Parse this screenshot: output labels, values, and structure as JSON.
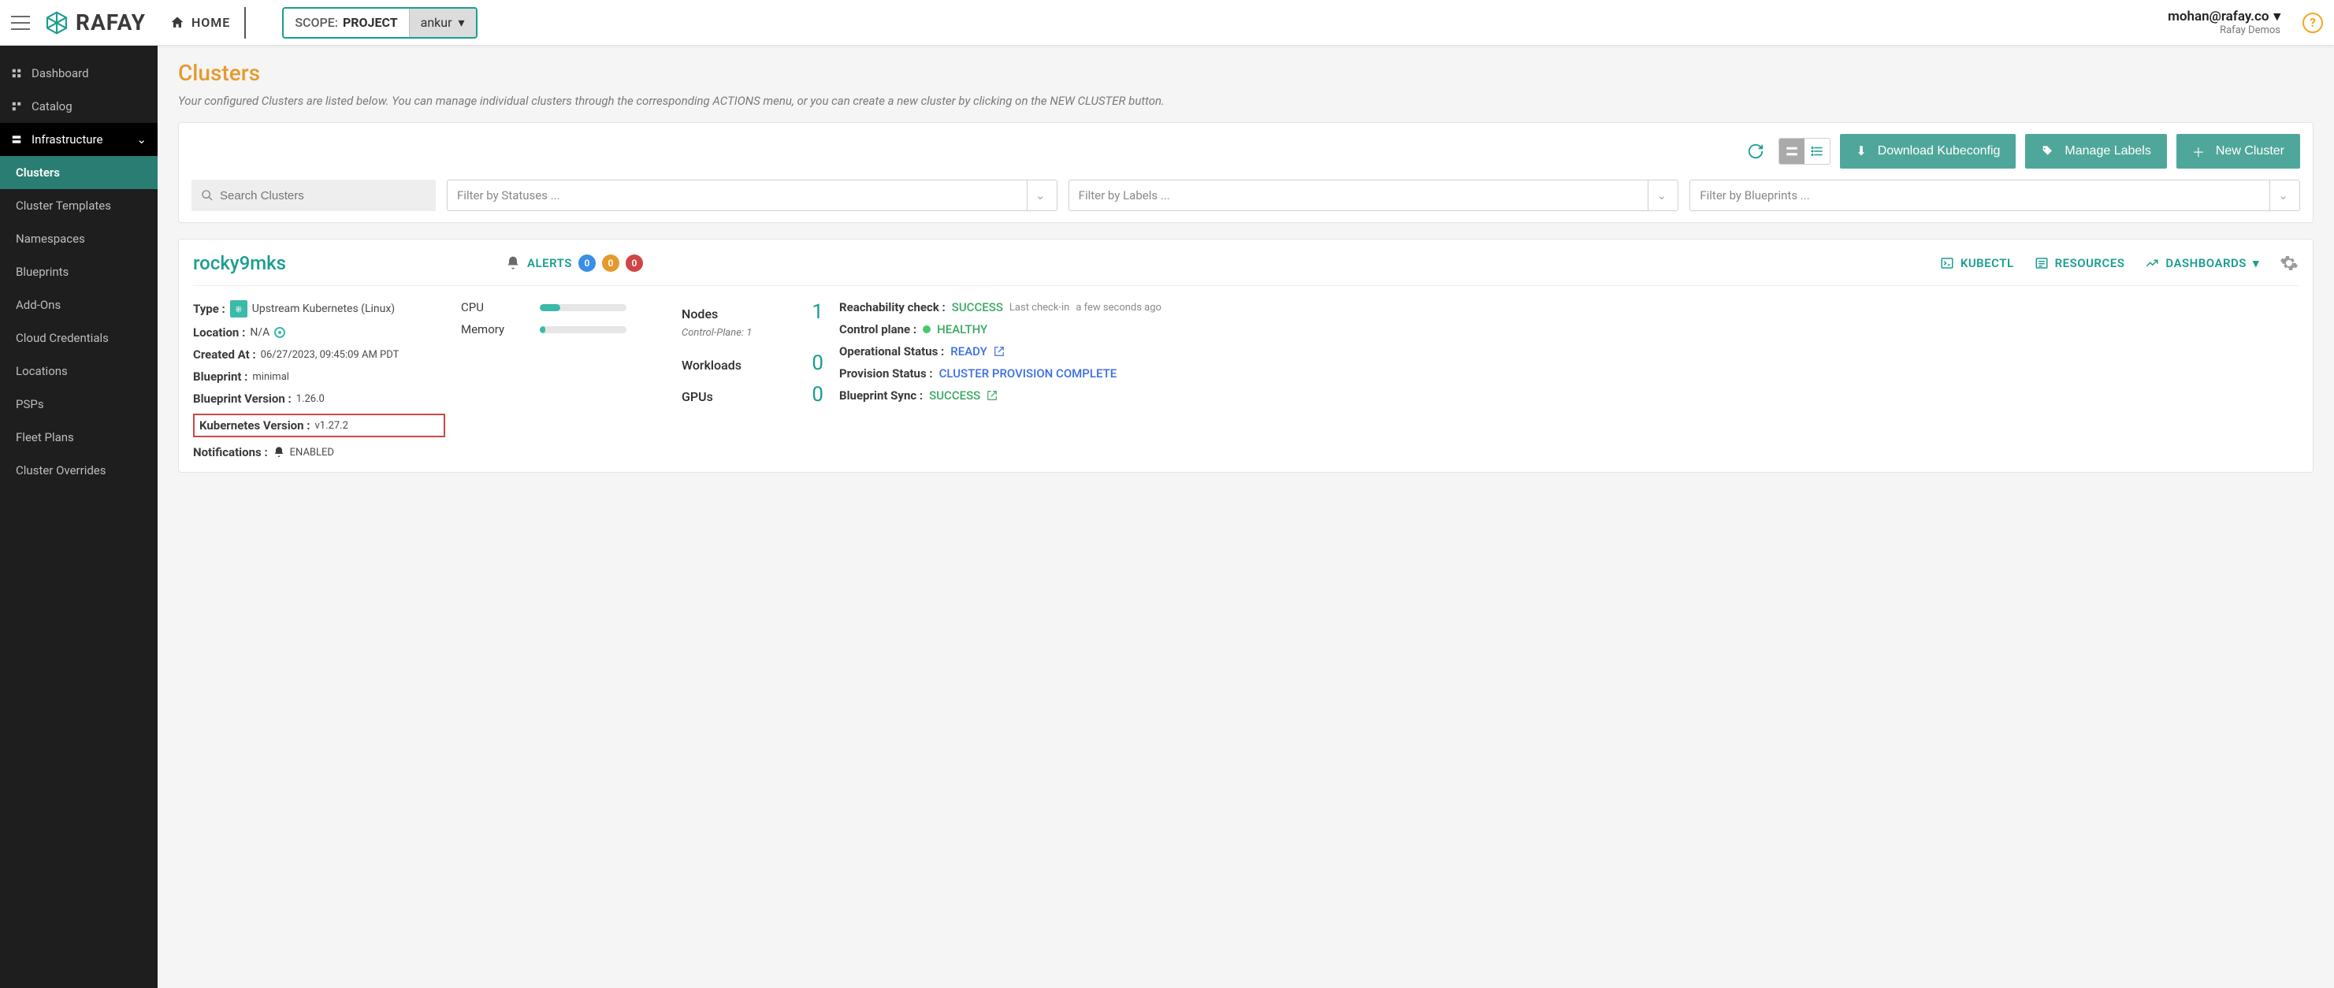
{
  "header": {
    "home": "HOME",
    "scope_label": "SCOPE:",
    "scope_value": "PROJECT",
    "scope_selected": "ankur",
    "user_email": "mohan@rafay.co",
    "user_org": "Rafay Demos"
  },
  "sidebar": {
    "items": [
      {
        "label": "Dashboard"
      },
      {
        "label": "Catalog"
      },
      {
        "label": "Infrastructure"
      }
    ],
    "sub_items": [
      {
        "label": "Clusters"
      },
      {
        "label": "Cluster Templates"
      },
      {
        "label": "Namespaces"
      },
      {
        "label": "Blueprints"
      },
      {
        "label": "Add-Ons"
      },
      {
        "label": "Cloud Credentials"
      },
      {
        "label": "Locations"
      },
      {
        "label": "PSPs"
      },
      {
        "label": "Fleet Plans"
      },
      {
        "label": "Cluster Overrides"
      }
    ]
  },
  "page": {
    "title": "Clusters",
    "description": "Your configured Clusters are listed below. You can manage individual clusters through the corresponding ACTIONS menu, or you can create a new cluster by clicking on the NEW CLUSTER button."
  },
  "toolbar": {
    "download": "Download Kubeconfig",
    "manage_labels": "Manage Labels",
    "new_cluster": "New Cluster",
    "search_placeholder": "Search Clusters",
    "filter_status": "Filter by Statuses ...",
    "filter_labels": "Filter by Labels ...",
    "filter_blueprints": "Filter by Blueprints ..."
  },
  "cluster": {
    "name": "rocky9mks",
    "alerts_label": "ALERTS",
    "alerts": {
      "info": "0",
      "warn": "0",
      "err": "0"
    },
    "links": {
      "kubectl": "KUBECTL",
      "resources": "RESOURCES",
      "dashboards": "DASHBOARDS"
    },
    "type_label": "Type :",
    "type_value": "Upstream Kubernetes (Linux)",
    "location_label": "Location :",
    "location_value": "N/A",
    "created_label": "Created At :",
    "created_value": "06/27/2023, 09:45:09 AM PDT",
    "blueprint_label": "Blueprint :",
    "blueprint_value": "minimal",
    "bp_version_label": "Blueprint Version :",
    "bp_version_value": "1.26.0",
    "k8s_version_label": "Kubernetes Version :",
    "k8s_version_value": "v1.27.2",
    "notifications_label": "Notifications :",
    "notifications_value": "ENABLED",
    "cpu_label": "CPU",
    "memory_label": "Memory",
    "cpu_pct": 24,
    "mem_pct": 6,
    "nodes_label": "Nodes",
    "nodes_value": "1",
    "control_plane_note": "Control-Plane: 1",
    "workloads_label": "Workloads",
    "workloads_value": "0",
    "gpus_label": "GPUs",
    "gpus_value": "0",
    "reach_label": "Reachability check :",
    "reach_value": "SUCCESS",
    "reach_note_a": "Last check-in",
    "reach_note_b": "a few seconds ago",
    "cp_label": "Control plane :",
    "cp_value": "HEALTHY",
    "op_label": "Operational Status :",
    "op_value": "READY",
    "prov_label": "Provision Status :",
    "prov_value": "CLUSTER PROVISION COMPLETE",
    "sync_label": "Blueprint Sync :",
    "sync_value": "SUCCESS"
  }
}
